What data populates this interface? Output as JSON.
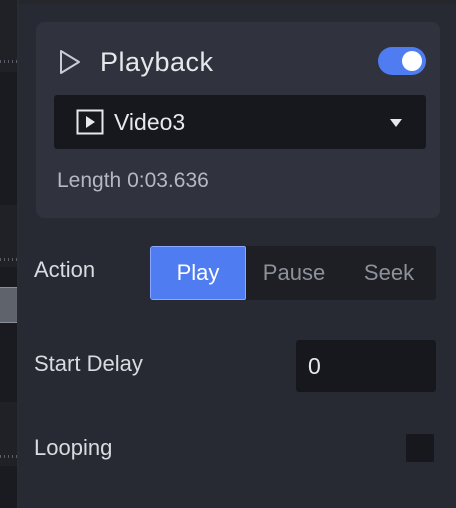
{
  "playback": {
    "title": "Playback",
    "enabled": true,
    "clip": {
      "selected": "Video3"
    },
    "length_text": "Length 0:03.636"
  },
  "fields": {
    "action": {
      "label": "Action",
      "options": [
        "Play",
        "Pause",
        "Seek"
      ],
      "selected": "Play"
    },
    "start_delay": {
      "label": "Start Delay",
      "value": "0"
    },
    "looping": {
      "label": "Looping",
      "checked": false
    }
  },
  "colors": {
    "accent": "#4f7cf0",
    "panel_bg": "#272a33",
    "card_bg": "#30333d",
    "input_bg": "#16181d"
  },
  "icons": {
    "title": "play-outline-icon",
    "clip": "video-file-icon",
    "dropdown": "chevron-down-icon"
  }
}
